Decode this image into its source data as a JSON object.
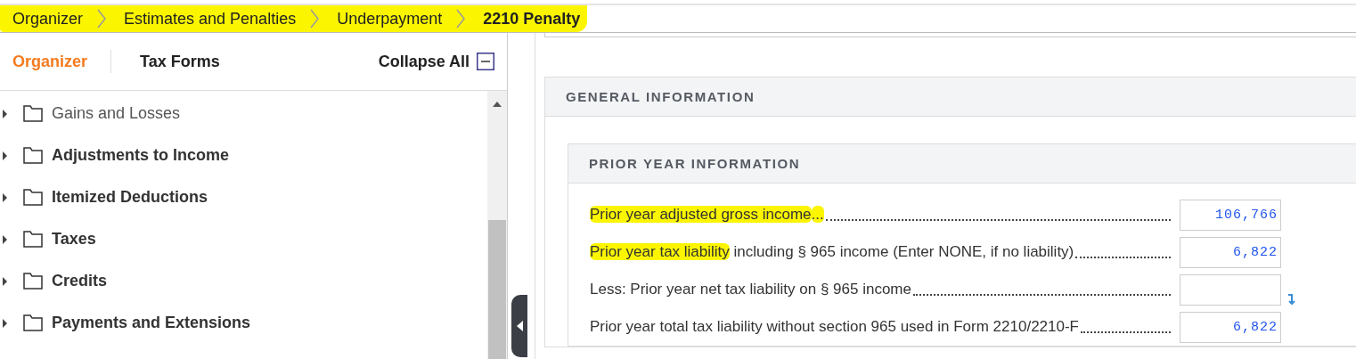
{
  "breadcrumb": {
    "highlighted": true,
    "items": [
      {
        "label": "Organizer",
        "current": false
      },
      {
        "label": "Estimates and Penalties",
        "current": false
      },
      {
        "label": "Underpayment",
        "current": false
      },
      {
        "label": "2210 Penalty",
        "current": true
      }
    ]
  },
  "sidebar": {
    "tabs": [
      {
        "label": "Organizer",
        "selected": true
      },
      {
        "label": "Tax Forms",
        "selected": false
      }
    ],
    "collapse_all": "Collapse All",
    "items": [
      {
        "label": "Gains and Losses",
        "bold": false,
        "expanded": false
      },
      {
        "label": "Adjustments to Income",
        "bold": true,
        "expanded": false
      },
      {
        "label": "Itemized Deductions",
        "bold": true,
        "expanded": false
      },
      {
        "label": "Taxes",
        "bold": true,
        "expanded": false
      },
      {
        "label": "Credits",
        "bold": true,
        "expanded": false
      },
      {
        "label": "Payments and Extensions",
        "bold": true,
        "expanded": false
      }
    ]
  },
  "section": {
    "title": "GENERAL INFORMATION",
    "subsection": {
      "title": "PRIOR YEAR INFORMATION",
      "rows": [
        {
          "label": [
            {
              "text": "Prior year adjusted gross income",
              "highlighted": true
            },
            {
              "text": "...",
              "highlighted": true
            }
          ],
          "value": "106,766",
          "arrow": false
        },
        {
          "label": [
            {
              "text": "Prior year tax liability",
              "highlighted": true
            },
            {
              "text": " including § 965 income (Enter NONE, if no liability)",
              "highlighted": false
            }
          ],
          "value": "6,822",
          "arrow": false
        },
        {
          "label": [
            {
              "text": "Less: Prior year net tax liability on § 965 income",
              "highlighted": false
            }
          ],
          "arrow": true
        },
        {
          "label": [
            {
              "text": "Prior year total tax liability without section 965 used in Form 2210/2210-F",
              "highlighted": false
            }
          ],
          "value": "6,822",
          "arrow": false
        }
      ]
    }
  }
}
